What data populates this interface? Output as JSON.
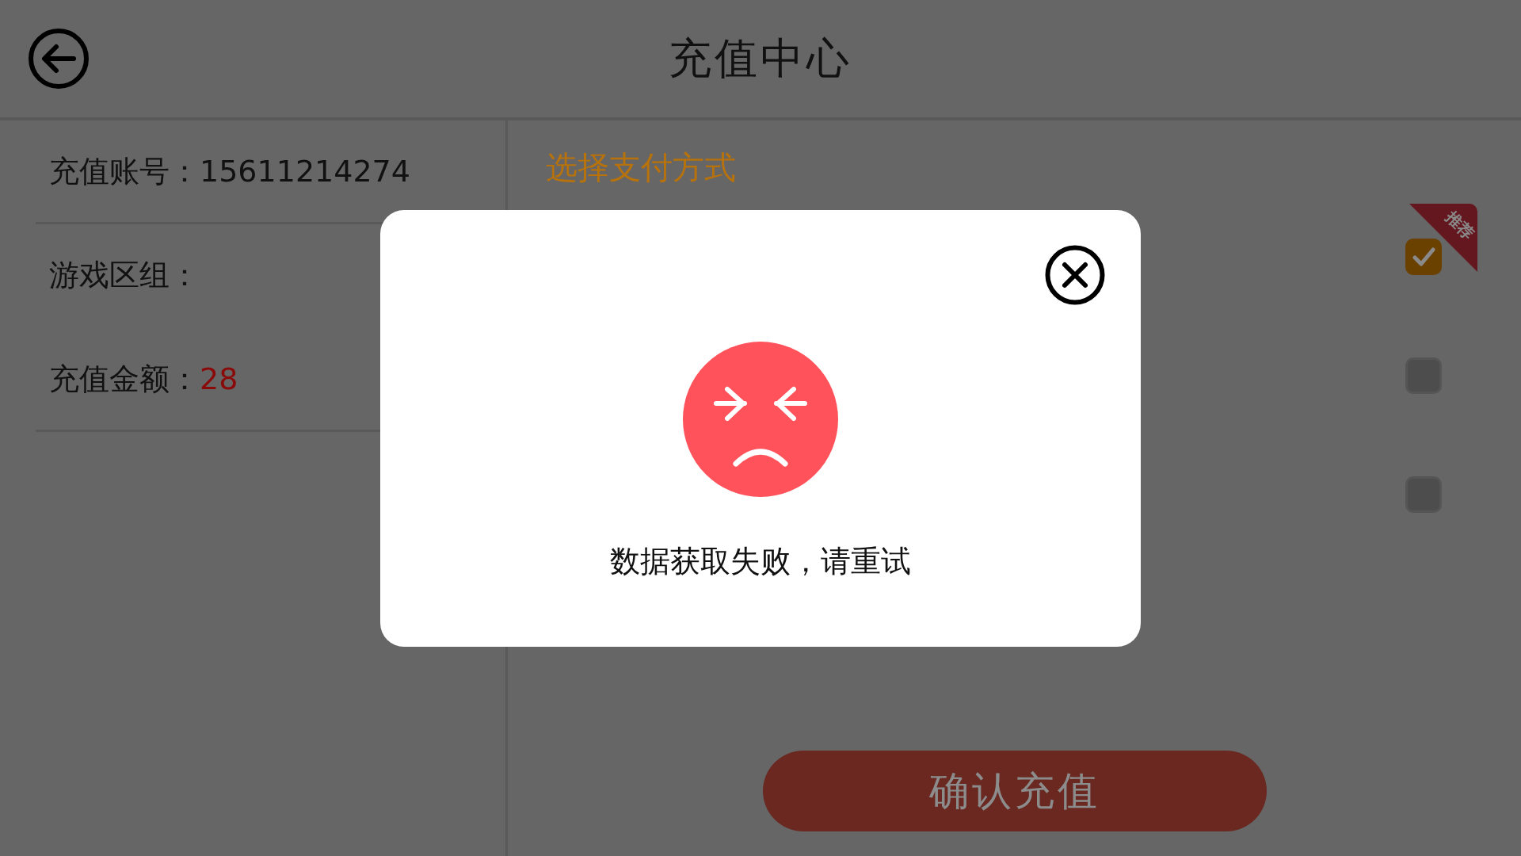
{
  "header": {
    "title": "充值中心"
  },
  "order_info": [
    {
      "kind": "text",
      "label": "充值账号：",
      "value": "15611214274",
      "divider_below": true
    },
    {
      "label": "游戏区组：",
      "divider_below": false
    },
    {
      "kind": "amount",
      "label": "充值金额：",
      "value": "28",
      "divider_below": true
    }
  ],
  "payment": {
    "title": "选择支付方式",
    "options": [
      {
        "selected": true,
        "badge": "推荐"
      },
      {
        "selected": false
      },
      {
        "selected": false
      }
    ]
  },
  "confirm_button": "确认充值",
  "dialog": {
    "message": "数据获取失败，请重试"
  }
}
